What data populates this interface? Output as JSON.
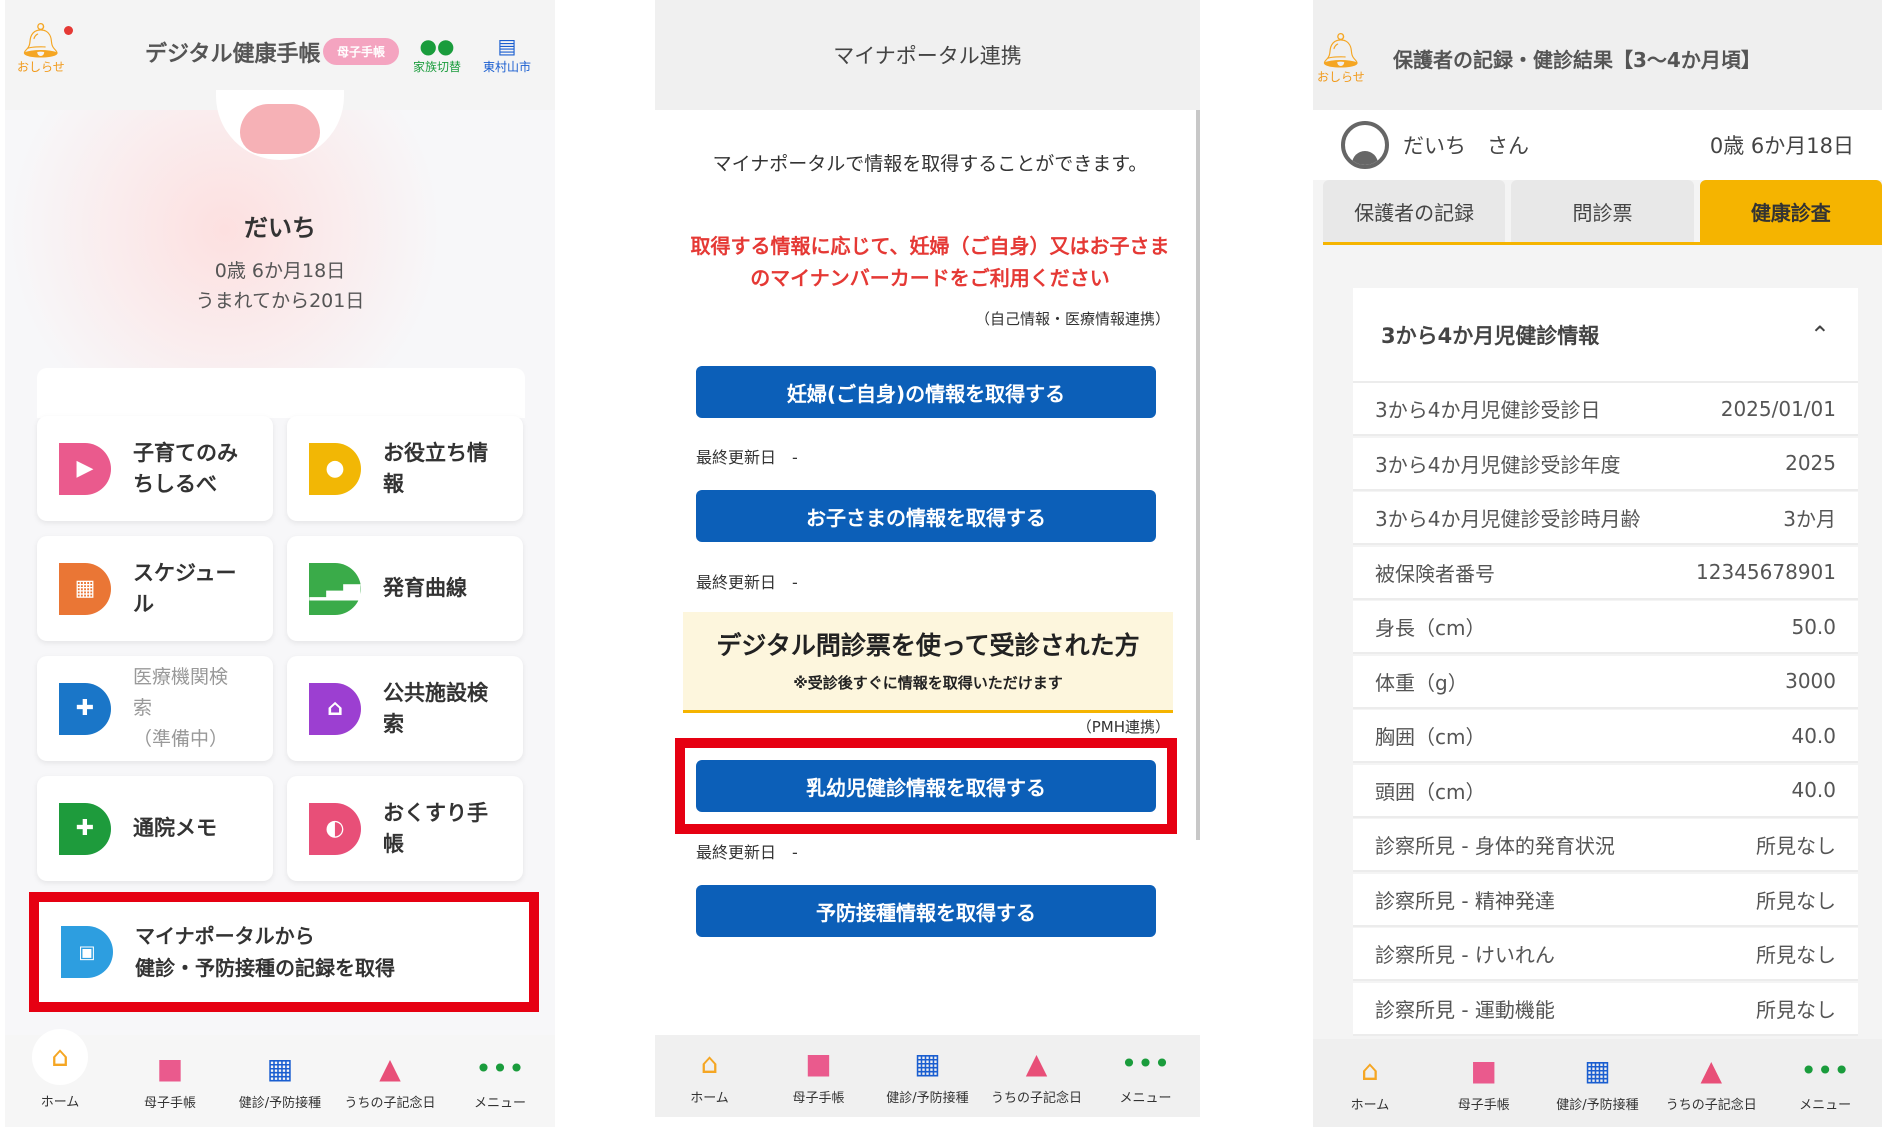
{
  "colors": {
    "highlight": "#e60012",
    "primary_blue": "#0c5fb8",
    "accent_yellow": "#f5b400",
    "alert_red": "#e53935"
  },
  "home": {
    "notification_label": "おしらせ",
    "app_title": "デジタル健康手帳",
    "title_badge": "母子手帳",
    "family_switch_label": "家族切替",
    "city_label": "東村山市",
    "child_name": "だいち",
    "age": "0歳 6か月18日",
    "days_since_birth": "うまれてから201日",
    "tiles": [
      {
        "label": "子育てのみ\nちしるべ",
        "color": "#ea5a8d",
        "icon": "megaphone-icon"
      },
      {
        "label": "お役立ち情\n報",
        "color": "#f2b705",
        "icon": "lightbulb-icon"
      },
      {
        "label": "スケジュー\nル",
        "color": "#ea7635",
        "icon": "calendar-icon"
      },
      {
        "label": "発育曲線",
        "color": "#3aab49",
        "icon": "bar-chart-icon"
      },
      {
        "label": "医療機関検\n索\n（準備中）",
        "color": "#1a76c8",
        "icon": "hospital-icon"
      },
      {
        "label": "公共施設検\n索",
        "color": "#9c3fd1",
        "icon": "house-icon"
      },
      {
        "label": "通院メモ",
        "color": "#1e9b3c",
        "icon": "memo-icon"
      },
      {
        "label": "おくすり手\n帳",
        "color": "#e84f78",
        "icon": "pill-icon"
      }
    ],
    "mynaportal_tile": {
      "line1": "マイナポータルから",
      "line2": "健診・予防接種の記録を取得",
      "color": "#2d9ee0"
    }
  },
  "nav": {
    "home": "ホーム",
    "boshi": "母子手帳",
    "checkup": "健診/予防接種",
    "anniversary": "うちの子記念日",
    "menu": "メニュー"
  },
  "mynaportal": {
    "header": "マイナポータル連携",
    "intro": "マイナポータルで情報を取得することができます。",
    "warning": "取得する情報に応じて、妊婦（ご自身）又はお子さまのマイナンバーカードをご利用ください",
    "note_self": "（自己情報・医療情報連携）",
    "btn_mother": "妊婦(ご自身)の情報を取得する",
    "updated_label": "最終更新日　-",
    "btn_child": "お子さまの情報を取得する",
    "digital_title": "デジタル問診票を使って受診された方",
    "digital_sub": "※受診後すぐに情報を取得いただけます",
    "note_pmh": "（PMH連携）",
    "btn_infant": "乳幼児健診情報を取得する",
    "btn_vaccine": "予防接種情報を取得する"
  },
  "results": {
    "notification_label": "おしらせ",
    "header": "保護者の記録・健診結果【3～4か月頃】",
    "child_name": "だいち　さん",
    "age": "0歳 6か月18日",
    "tabs": [
      "保護者の記録",
      "問診票",
      "健康診査"
    ],
    "section_title": "3から4か月児健診情報",
    "rows": [
      {
        "label": "3から4か月児健診受診日",
        "value": "2025/01/01"
      },
      {
        "label": "3から4か月児健診受診年度",
        "value": "2025"
      },
      {
        "label": "3から4か月児健診受診時月齢",
        "value": "3か月"
      },
      {
        "label": "被保険者番号",
        "value": "12345678901"
      },
      {
        "label": "身長（cm）",
        "value": "50.0"
      },
      {
        "label": "体重（g）",
        "value": "3000"
      },
      {
        "label": "胸囲（cm）",
        "value": "40.0"
      },
      {
        "label": "頭囲（cm）",
        "value": "40.0"
      },
      {
        "label": "診察所見 - 身体的発育状況",
        "value": "所見なし"
      },
      {
        "label": "診察所見 - 精神発達",
        "value": "所見なし"
      },
      {
        "label": "診察所見 - けいれん",
        "value": "所見なし"
      },
      {
        "label": "診察所見 - 運動機能",
        "value": "所見なし"
      }
    ]
  }
}
